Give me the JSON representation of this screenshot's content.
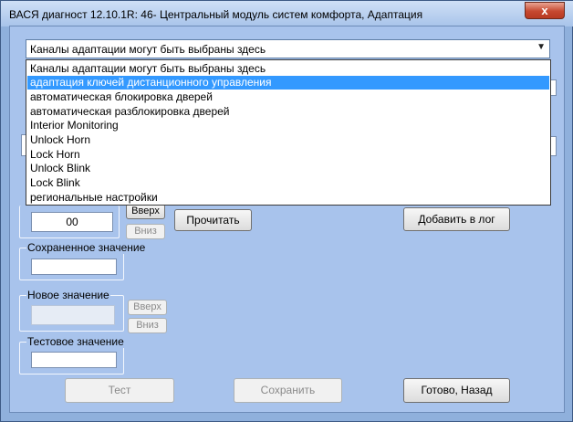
{
  "window": {
    "title": "ВАСЯ диагност 12.10.1R: 46- Центральный модуль систем комфорта, Адаптация",
    "close_glyph": "x"
  },
  "channel_select": {
    "value": "Каналы адаптации могут быть выбраны здесь",
    "options": [
      "Каналы адаптации могут быть выбраны здесь",
      "адаптация ключей дистанционного управления",
      "автоматическая блокировка дверей",
      "автоматическая разблокировка дверей",
      "Interior Monitoring",
      "Unlock Horn",
      "Lock Horn",
      "Unlock Blink",
      "Lock Blink",
      "региональные настройки"
    ],
    "highlighted_index": 1
  },
  "channel": {
    "value": "00",
    "up_label": "Вверх",
    "down_label": "Вниз"
  },
  "read_button": "Прочитать",
  "add_log_button": "Добавить в лог",
  "saved_value": {
    "label": "Сохраненное значение",
    "value": ""
  },
  "new_value": {
    "label": "Новое значение",
    "value": "",
    "up_label": "Вверх",
    "down_label": "Вниз"
  },
  "test_value": {
    "label": "Тестовое значение",
    "value": ""
  },
  "buttons": {
    "test": "Тест",
    "save": "Сохранить",
    "done": "Готово, Назад"
  }
}
